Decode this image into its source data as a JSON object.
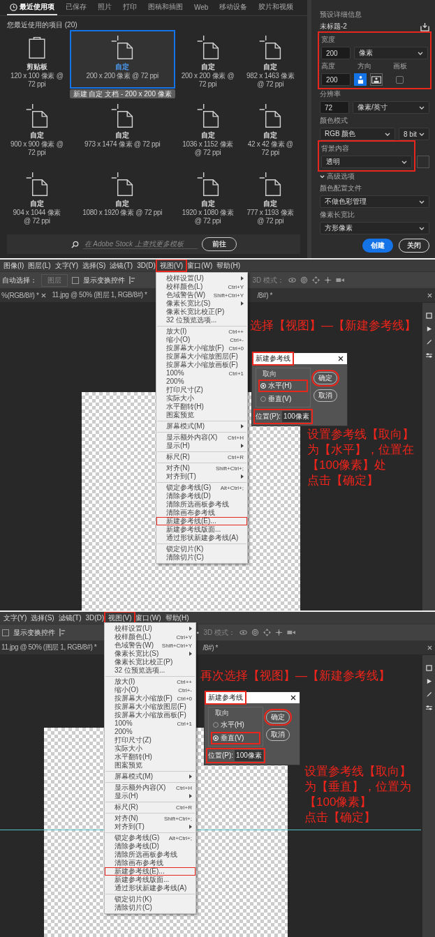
{
  "new_document": {
    "tabs": [
      {
        "label": "最近使用项",
        "selected": true
      },
      {
        "label": "已保存",
        "selected": false
      },
      {
        "label": "照片",
        "selected": false
      },
      {
        "label": "打印",
        "selected": false
      },
      {
        "label": "图稿和插图",
        "selected": false
      },
      {
        "label": "Web",
        "selected": false
      },
      {
        "label": "移动设备",
        "selected": false
      },
      {
        "label": "胶片和视频",
        "selected": false
      }
    ],
    "recent_heading": "您最近使用的项目 (20)",
    "presets": [
      {
        "kind": "clipboard",
        "name": "剪贴板",
        "size": "120 x 100 像素 @ 72 ppi",
        "selected": false
      },
      {
        "kind": "document",
        "name": "自定",
        "size": "200 x 200 像素 @ 72 ppi",
        "selected": true
      },
      {
        "kind": "document",
        "name": "自定",
        "size": "200 x 200 像素 @ 72 ppi",
        "selected": false
      },
      {
        "kind": "document",
        "name": "自定",
        "size": "982 x 1463 像素 @ 72 ppi",
        "selected": false
      },
      {
        "kind": "document",
        "name": "自定",
        "size": "900 x 900 像素 @ 72 ppi",
        "selected": false
      },
      {
        "kind": "document",
        "name": "自定",
        "size": "973 x 1474 像素 @ 72 ppi",
        "selected": false
      },
      {
        "kind": "document",
        "name": "自定",
        "size": "1036 x 1152 像素 @ 72 ppi",
        "selected": false
      },
      {
        "kind": "document",
        "name": "自定",
        "size": "42 x 42 像素 @ 72 ppi",
        "selected": false
      },
      {
        "kind": "document",
        "name": "自定",
        "size": "904 x 1044 像素 @ 72 ppi",
        "selected": false
      },
      {
        "kind": "document",
        "name": "自定",
        "size": "1080 x 1920 像素 @ 72 ppi",
        "selected": false
      },
      {
        "kind": "document",
        "name": "自定",
        "size": "1920 x 1080 像素 @ 72 ppi",
        "selected": false
      },
      {
        "kind": "document",
        "name": "自定",
        "size": "777 x 1193 像素 @ 72 ppi",
        "selected": false
      }
    ],
    "tooltip": "新建 自定 文档 - 200 x 200 像素",
    "stock_search": {
      "placeholder": "在 Adobe Stock 上查找更多模板",
      "button": "前往"
    },
    "details": {
      "section_label": "预设详细信息",
      "doc_name": "未标题-2",
      "size_highlighted": true,
      "width_label": "宽度",
      "width_value": "200",
      "width_unit": "像素",
      "height_label": "高度",
      "height_value": "200",
      "orientation_label": "方向",
      "artboard_label": "画板",
      "orientations": [
        {
          "kind": "portrait",
          "selected": true
        },
        {
          "kind": "landscape",
          "selected": false
        }
      ],
      "artboard_checked": false,
      "resolution_label": "分辨率",
      "resolution_value": "72",
      "resolution_unit": "像素/英寸",
      "color_mode_label": "颜色模式",
      "color_mode": "RGB 颜色",
      "bit_depth": "8 bit",
      "background_label": "背景内容",
      "background": "透明",
      "background_highlighted": true,
      "advanced_label": "高级选项",
      "advanced_expanded": true,
      "color_profile_label": "颜色配置文件",
      "color_profile": "不做色彩管理",
      "pixel_aspect_label": "像素长宽比",
      "pixel_aspect": "方形像素"
    },
    "create_button": "创建",
    "close_button": "关闭"
  },
  "steps": [
    {
      "menubar": [
        {
          "label": "图像(I)",
          "highlighted": false
        },
        {
          "label": "图层(L)",
          "highlighted": false
        },
        {
          "label": "文字(Y)",
          "highlighted": false
        },
        {
          "label": "选择(S)",
          "highlighted": false
        },
        {
          "label": "滤镜(T)",
          "highlighted": false
        },
        {
          "label": "3D(D)",
          "highlighted": false
        },
        {
          "label": "视图(V)",
          "highlighted": true
        },
        {
          "label": "窗口(W)",
          "highlighted": false
        },
        {
          "label": "帮助(H)",
          "highlighted": false
        }
      ],
      "options_bar": {
        "auto_select_label": "自动选择：",
        "layer_dropdown": "图层",
        "show_transform_label": "显示变换控件",
        "show_transform_checked": false,
        "mode_label": "3D 模式："
      },
      "doc_tabs": [
        "%(RGB/8#) *",
        "11.jpg @ 50% (图层 1, RGB/8#) *",
        "/8#) *"
      ],
      "view_menu": [
        {
          "kind": "item",
          "label": "校样设置(U)",
          "submenu": true,
          "highlighted": false
        },
        {
          "kind": "item",
          "label": "校样颜色(L)",
          "shortcut": "Ctrl+Y",
          "highlighted": false
        },
        {
          "kind": "item",
          "label": "色域警告(W)",
          "shortcut": "Shift+Ctrl+Y",
          "highlighted": false
        },
        {
          "kind": "item",
          "label": "像素长宽比(S)",
          "submenu": true,
          "highlighted": false
        },
        {
          "kind": "item",
          "label": "像素长宽比校正(P)",
          "highlighted": false
        },
        {
          "kind": "item",
          "label": "32 位预览选项...",
          "highlighted": false
        },
        {
          "kind": "separator"
        },
        {
          "kind": "item",
          "label": "放大(I)",
          "shortcut": "Ctrl++",
          "highlighted": false
        },
        {
          "kind": "item",
          "label": "缩小(O)",
          "shortcut": "Ctrl+-",
          "highlighted": false
        },
        {
          "kind": "item",
          "label": "按屏幕大小缩放(F)",
          "shortcut": "Ctrl+0",
          "highlighted": false
        },
        {
          "kind": "item",
          "label": "按屏幕大小缩放图层(F)",
          "highlighted": false
        },
        {
          "kind": "item",
          "label": "按屏幕大小缩放画板(F)",
          "highlighted": false
        },
        {
          "kind": "item",
          "label": "100%",
          "shortcut": "Ctrl+1",
          "highlighted": false
        },
        {
          "kind": "item",
          "label": "200%",
          "highlighted": false
        },
        {
          "kind": "item",
          "label": "打印尺寸(Z)",
          "highlighted": false
        },
        {
          "kind": "item",
          "label": "实际大小",
          "highlighted": false
        },
        {
          "kind": "item",
          "label": "水平翻转(H)",
          "highlighted": false
        },
        {
          "kind": "item",
          "label": "图案预览",
          "highlighted": false
        },
        {
          "kind": "separator"
        },
        {
          "kind": "item",
          "label": "屏幕模式(M)",
          "submenu": true,
          "highlighted": false
        },
        {
          "kind": "separator"
        },
        {
          "kind": "item",
          "label": "显示额外内容(X)",
          "shortcut": "Ctrl+H",
          "highlighted": false
        },
        {
          "kind": "item",
          "label": "显示(H)",
          "submenu": true,
          "highlighted": false
        },
        {
          "kind": "separator"
        },
        {
          "kind": "item",
          "label": "标尺(R)",
          "shortcut": "Ctrl+R",
          "highlighted": false
        },
        {
          "kind": "separator"
        },
        {
          "kind": "item",
          "label": "对齐(N)",
          "shortcut": "Shift+Ctrl+;",
          "highlighted": false
        },
        {
          "kind": "item",
          "label": "对齐到(T)",
          "submenu": true,
          "highlighted": false
        },
        {
          "kind": "separator"
        },
        {
          "kind": "item",
          "label": "锁定参考线(G)",
          "shortcut": "Alt+Ctrl+;",
          "highlighted": false
        },
        {
          "kind": "item",
          "label": "清除参考线(D)",
          "highlighted": false
        },
        {
          "kind": "item",
          "label": "清除所选画板参考线",
          "highlighted": false
        },
        {
          "kind": "item",
          "label": "清除画布参考线",
          "highlighted": false
        },
        {
          "kind": "item",
          "label": "新建参考线(E)...",
          "highlighted": true
        },
        {
          "kind": "item",
          "label": "新建参考线版面...",
          "highlighted": false
        },
        {
          "kind": "item",
          "label": "通过形状新建参考线(A)",
          "highlighted": false
        },
        {
          "kind": "separator"
        },
        {
          "kind": "item",
          "label": "锁定切片(K)",
          "highlighted": false
        },
        {
          "kind": "item",
          "label": "清除切片(C)",
          "highlighted": false
        }
      ],
      "dialog": {
        "title": "新建参考线",
        "title_highlighted": true,
        "group_label": "取向",
        "options": [
          {
            "label": "水平(H)",
            "selected": true,
            "highlighted": true
          },
          {
            "label": "垂直(V)",
            "selected": false,
            "highlighted": false
          }
        ],
        "position_label": "位置(P):",
        "position_value": "100像素",
        "position_highlighted": true,
        "ok_button": "确定",
        "ok_highlighted": true,
        "cancel_button": "取消"
      },
      "caption": "选择【视图】—【新建参考线】",
      "instructions": [
        "设置参考线【取向】",
        "为【水平】，位置在",
        "【100像素】处",
        "点击【确定】"
      ],
      "guide_visible": false
    },
    {
      "menubar": [
        {
          "label": "文字(Y)",
          "highlighted": false
        },
        {
          "label": "选择(S)",
          "highlighted": false
        },
        {
          "label": "滤镜(T)",
          "highlighted": false
        },
        {
          "label": "3D(D)",
          "highlighted": false
        },
        {
          "label": "视图(V)",
          "highlighted": true
        },
        {
          "label": "窗口(W)",
          "highlighted": false
        },
        {
          "label": "帮助(H)",
          "highlighted": false
        }
      ],
      "options_bar": {
        "show_transform_label": "显示变换控件",
        "show_transform_checked": false,
        "mode_label": "3D 模式："
      },
      "doc_tabs": [
        "11.jpg @ 50% (图层 1, RGB/8#) *",
        "/8#) *"
      ],
      "view_menu": [
        {
          "kind": "item",
          "label": "校样设置(U)",
          "submenu": true,
          "highlighted": false
        },
        {
          "kind": "item",
          "label": "校样颜色(L)",
          "shortcut": "Ctrl+Y",
          "highlighted": false
        },
        {
          "kind": "item",
          "label": "色域警告(W)",
          "shortcut": "Shift+Ctrl+Y",
          "highlighted": false
        },
        {
          "kind": "item",
          "label": "像素长宽比(S)",
          "submenu": true,
          "highlighted": false
        },
        {
          "kind": "item",
          "label": "像素长宽比校正(P)",
          "highlighted": false
        },
        {
          "kind": "item",
          "label": "32 位预览选项...",
          "highlighted": false
        },
        {
          "kind": "separator"
        },
        {
          "kind": "item",
          "label": "放大(I)",
          "shortcut": "Ctrl++",
          "highlighted": false
        },
        {
          "kind": "item",
          "label": "缩小(O)",
          "shortcut": "Ctrl+-",
          "highlighted": false
        },
        {
          "kind": "item",
          "label": "按屏幕大小缩放(F)",
          "shortcut": "Ctrl+0",
          "highlighted": false
        },
        {
          "kind": "item",
          "label": "按屏幕大小缩放图层(F)",
          "highlighted": false
        },
        {
          "kind": "item",
          "label": "按屏幕大小缩放画板(F)",
          "highlighted": false
        },
        {
          "kind": "item",
          "label": "100%",
          "shortcut": "Ctrl+1",
          "highlighted": false
        },
        {
          "kind": "item",
          "label": "200%",
          "highlighted": false
        },
        {
          "kind": "item",
          "label": "打印尺寸(Z)",
          "highlighted": false
        },
        {
          "kind": "item",
          "label": "实际大小",
          "highlighted": false
        },
        {
          "kind": "item",
          "label": "水平翻转(H)",
          "highlighted": false
        },
        {
          "kind": "item",
          "label": "图案预览",
          "highlighted": false
        },
        {
          "kind": "separator"
        },
        {
          "kind": "item",
          "label": "屏幕模式(M)",
          "submenu": true,
          "highlighted": false
        },
        {
          "kind": "separator"
        },
        {
          "kind": "item",
          "label": "显示额外内容(X)",
          "shortcut": "Ctrl+H",
          "highlighted": false
        },
        {
          "kind": "item",
          "label": "显示(H)",
          "submenu": true,
          "highlighted": false
        },
        {
          "kind": "separator"
        },
        {
          "kind": "item",
          "label": "标尺(R)",
          "shortcut": "Ctrl+R",
          "highlighted": false
        },
        {
          "kind": "separator"
        },
        {
          "kind": "item",
          "label": "对齐(N)",
          "shortcut": "Shift+Ctrl+;",
          "highlighted": false
        },
        {
          "kind": "item",
          "label": "对齐到(T)",
          "submenu": true,
          "highlighted": false
        },
        {
          "kind": "separator"
        },
        {
          "kind": "item",
          "label": "锁定参考线(G)",
          "shortcut": "Alt+Ctrl+;",
          "highlighted": false
        },
        {
          "kind": "item",
          "label": "清除参考线(D)",
          "highlighted": false
        },
        {
          "kind": "item",
          "label": "清除所选画板参考线",
          "highlighted": false
        },
        {
          "kind": "item",
          "label": "清除画布参考线",
          "highlighted": false
        },
        {
          "kind": "item",
          "label": "新建参考线(E)...",
          "highlighted": true
        },
        {
          "kind": "item",
          "label": "新建参考线版面...",
          "highlighted": false
        },
        {
          "kind": "item",
          "label": "通过形状新建参考线(A)",
          "highlighted": false
        },
        {
          "kind": "separator"
        },
        {
          "kind": "item",
          "label": "锁定切片(K)",
          "highlighted": false
        },
        {
          "kind": "item",
          "label": "清除切片(C)",
          "highlighted": false
        }
      ],
      "dialog": {
        "title": "新建参考线",
        "title_highlighted": true,
        "group_label": "取向",
        "options": [
          {
            "label": "水平(H)",
            "selected": false,
            "highlighted": false
          },
          {
            "label": "垂直(V)",
            "selected": true,
            "highlighted": true
          }
        ],
        "position_label": "位置(P):",
        "position_value": "100像素",
        "position_highlighted": true,
        "ok_button": "确定",
        "ok_highlighted": true,
        "cancel_button": "取消"
      },
      "caption": "再次选择【视图】—【新建参考线】",
      "instructions": [
        "设置参考线【取向】",
        "为【垂直】，位置为",
        "【100像素】",
        "点击【确定】"
      ],
      "guide_visible": true
    }
  ]
}
